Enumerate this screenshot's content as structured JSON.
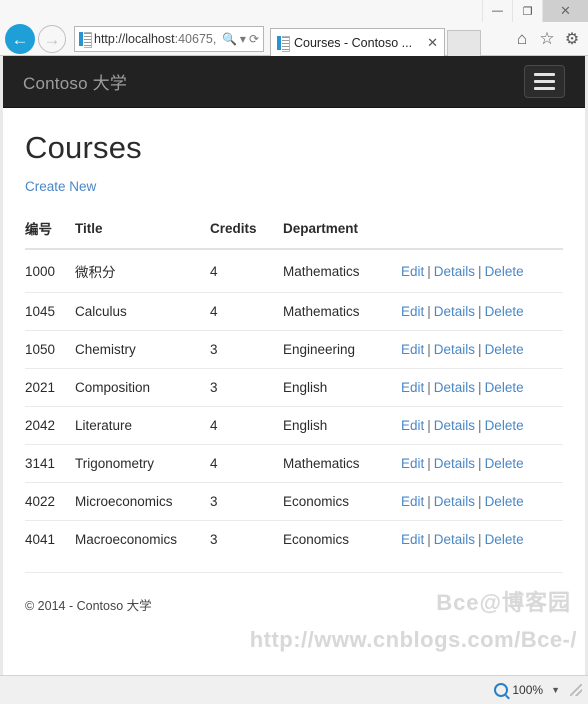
{
  "browser": {
    "window_controls": {
      "minimize": "—",
      "maximize": "❐",
      "close": "✕"
    },
    "back_label": "←",
    "forward_label": "→",
    "address_value": "http://localhost:40675,",
    "address_host": "http://localhost",
    "address_rest": ":40675,",
    "search_icon": "search-icon",
    "dropdown_caret": "▾",
    "refresh_icon": "⟳",
    "tab_title": "Courses - Contoso ...",
    "tab_close": "✕",
    "home_icon": "⌂",
    "favorites_icon": "☆",
    "settings_icon": "⚙"
  },
  "site": {
    "brand": "Contoso 大学",
    "menu_toggle": "navbar-toggle"
  },
  "page": {
    "title": "Courses",
    "create_new": "Create New",
    "footer": "© 2014 - Contoso 大学"
  },
  "table": {
    "headers": [
      "编号",
      "Title",
      "Credits",
      "Department"
    ],
    "actions": {
      "edit": "Edit",
      "details": "Details",
      "delete": "Delete",
      "separator": "|"
    },
    "rows": [
      {
        "id": "1000",
        "title": "微积分",
        "credits": "4",
        "department": "Mathematics"
      },
      {
        "id": "1045",
        "title": "Calculus",
        "credits": "4",
        "department": "Mathematics"
      },
      {
        "id": "1050",
        "title": "Chemistry",
        "credits": "3",
        "department": "Engineering"
      },
      {
        "id": "2021",
        "title": "Composition",
        "credits": "3",
        "department": "English"
      },
      {
        "id": "2042",
        "title": "Literature",
        "credits": "4",
        "department": "English"
      },
      {
        "id": "3141",
        "title": "Trigonometry",
        "credits": "4",
        "department": "Mathematics"
      },
      {
        "id": "4022",
        "title": "Microeconomics",
        "credits": "3",
        "department": "Economics"
      },
      {
        "id": "4041",
        "title": "Macroeconomics",
        "credits": "3",
        "department": "Economics"
      }
    ]
  },
  "watermarks": {
    "handle": "Bce@博客园",
    "url": "http://www.cnblogs.com/Bce-/"
  },
  "status_bar": {
    "zoom_level": "100%",
    "zoom_caret": "▼"
  },
  "colors": {
    "navbar_bg": "#222222",
    "link": "#4a87c7",
    "back_button": "#1e9fd8",
    "brand_text": "#9d9d9d"
  }
}
